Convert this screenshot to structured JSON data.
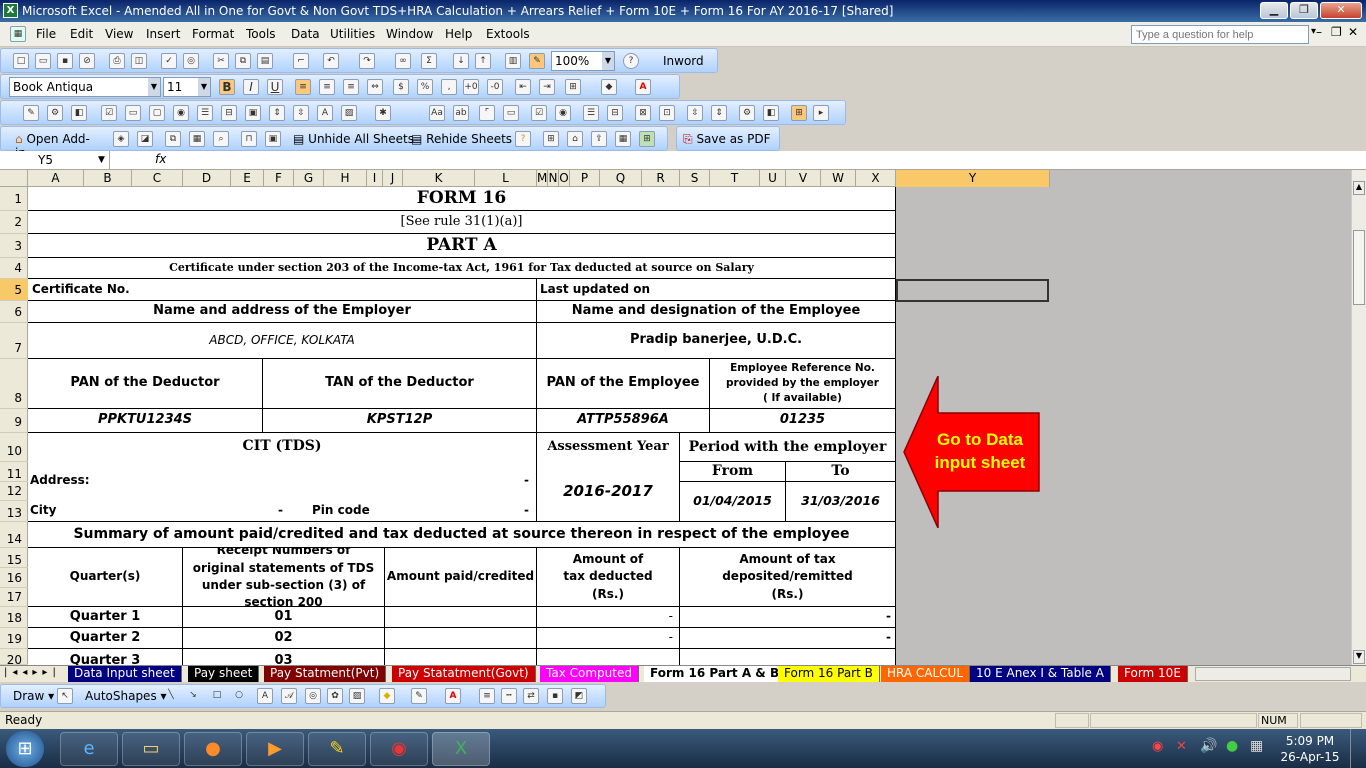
{
  "window": {
    "title": "Microsoft Excel - Amended All in One for Govt & Non Govt TDS+HRA Calculation + Arrears Relief + Form 10E + Form 16 For AY 2016-17  [Shared]"
  },
  "menu": {
    "items": [
      "File",
      "Edit",
      "View",
      "Insert",
      "Format",
      "Tools",
      "Data",
      "Utilities",
      "Window",
      "Help",
      "Extools"
    ],
    "help_placeholder": "Type a question for help"
  },
  "toolbar1": {
    "zoom": "100%",
    "inword": "Inword"
  },
  "toolbar2": {
    "font": "Book Antiqua",
    "size": "11",
    "bold": "B",
    "italic": "I",
    "underline": "U",
    "currency": "$",
    "percent": "%"
  },
  "toolbar4": {
    "open_addin": "Open Add-in",
    "unhide": "Unhide All Sheets",
    "rehide": "Rehide Sheets",
    "save_pdf": "Save as PDF"
  },
  "formula_bar": {
    "name_box": "Y5",
    "fx": "fx"
  },
  "columns": [
    "A",
    "B",
    "C",
    "D",
    "E",
    "F",
    "G",
    "H",
    "I",
    "J",
    "K",
    "L",
    "M",
    "N",
    "O",
    "P",
    "Q",
    "R",
    "S",
    "T",
    "U",
    "V",
    "W",
    "X",
    "Y"
  ],
  "rows": [
    "1",
    "2",
    "3",
    "4",
    "5",
    "6",
    "7",
    "8",
    "9",
    "10",
    "11",
    "12",
    "13",
    "14",
    "15",
    "16",
    "17",
    "18",
    "19",
    "20"
  ],
  "form": {
    "title": "FORM 16",
    "rule": "[See rule 31(1)(a)]",
    "part": "PART A",
    "cert_desc": "Certificate under section 203 of the Income-tax Act, 1961 for Tax deducted at source on Salary",
    "cert_no": "Certificate No.",
    "last_updated": "Last updated on",
    "employer_hdr": "Name and address of the Employer",
    "employee_hdr": "Name and designation of the Employee",
    "employer_val": "ABCD, OFFICE, KOLKATA",
    "employee_val": "Pradip banerjee, U.D.C.",
    "pan_deductor": "PAN of the Deductor",
    "tan_deductor": "TAN of the Deductor",
    "pan_employee": "PAN of the Employee",
    "emp_ref": "Employee Reference No. provided by the employer ( If available)",
    "pan_deductor_val": "PPKTU1234S",
    "tan_deductor_val": "KPST12P",
    "pan_employee_val": "ATTP55896A",
    "emp_ref_val": "01235",
    "cit": "CIT (TDS)",
    "assessment_year": "Assessment Year",
    "period": "Period with the employer",
    "address": "Address:",
    "dash": "-",
    "from": "From",
    "to": "To",
    "ay_val": "2016-2017",
    "from_val": "01/04/2015",
    "to_val": "31/03/2016",
    "city": "City",
    "pincode": "Pin code",
    "summary": "Summary of amount paid/credited and tax deducted at source thereon in respect of the employee",
    "quarters_hdr": "Quarter(s)",
    "receipt_hdr": "Receipt Numbers of original statements of TDS under sub-section (3) of section 200",
    "amount_paid_hdr": "Amount paid/credited",
    "tax_deducted_hdr": "Amount of tax deducted (Rs.)",
    "tax_deposited_hdr": "Amount of tax deposited/remitted (Rs.)",
    "quarters": [
      {
        "name": "Quarter 1",
        "receipt": "01"
      },
      {
        "name": "Quarter 2",
        "receipt": "02"
      },
      {
        "name": "Quarter 3",
        "receipt": "03"
      }
    ]
  },
  "callout": {
    "text": "Go to Data input sheet",
    "fill": "#ff0000",
    "text_color": "#ffff00"
  },
  "tabs": [
    {
      "label": "Data Input sheet",
      "bg": "#000080",
      "fg": "#ffffff"
    },
    {
      "label": "Pay sheet",
      "bg": "#000000",
      "fg": "#ffffff"
    },
    {
      "label": "Pay Statment(Pvt)",
      "bg": "#800000",
      "fg": "#ffffff"
    },
    {
      "label": "Pay Statatment(Govt)",
      "bg": "#cc0000",
      "fg": "#ffffff"
    },
    {
      "label": "Tax Computed",
      "bg": "#ff00ff",
      "fg": "#ffffff"
    },
    {
      "label": "Form 16 Part A & B",
      "bg": "#ffffff",
      "fg": "#000000"
    },
    {
      "label": "Form 16 Part B",
      "bg": "#ffff00",
      "fg": "#000000"
    },
    {
      "label": "HRA CALCUL",
      "bg": "#ff6600",
      "fg": "#ffffff"
    },
    {
      "label": "10 E Anex I & Table A",
      "bg": "#000080",
      "fg": "#ffffff"
    },
    {
      "label": "Form 10E",
      "bg": "#cc0000",
      "fg": "#ffffff"
    }
  ],
  "drawbar": {
    "draw": "Draw",
    "autoshapes": "AutoShapes"
  },
  "status": {
    "ready": "Ready",
    "num": "NUM"
  },
  "clock": {
    "time": "5:09 PM",
    "date": "26-Apr-15"
  }
}
